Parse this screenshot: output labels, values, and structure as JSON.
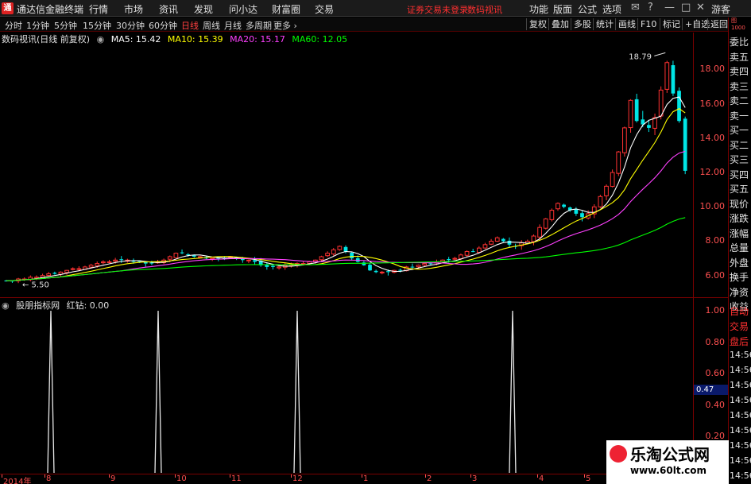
{
  "titlebar": {
    "app_name": "通达信金融终端",
    "menus": [
      "行情",
      "市场",
      "资讯",
      "发现",
      "问小达",
      "财富圈",
      "交易"
    ],
    "warning": "证券交易未登录",
    "stock_name": "数码视讯",
    "right_menus": [
      "功能",
      "版面",
      "公式",
      "选项"
    ],
    "user": "游客",
    "logo_char": "通"
  },
  "periodbar": {
    "periods": [
      "分时",
      "1分钟",
      "5分钟",
      "15分钟",
      "30分钟",
      "60分钟",
      "日线",
      "周线",
      "月线",
      "多周期",
      "更多 ›"
    ],
    "active": "日线",
    "right_buttons": [
      "复权",
      "叠加",
      "多股",
      "统计",
      "画线",
      "F10",
      "标记",
      "+自选",
      "返回"
    ]
  },
  "main_legend": {
    "title": "数码视讯(日线 前复权)",
    "ma5": "MA5: 15.42",
    "ma10": "MA10: 15.39",
    "ma20": "MA20: 15.17",
    "ma60": "MA60: 12.05"
  },
  "indicator_legend": {
    "name": "股朋指标网",
    "value": "红钻: 0.00"
  },
  "colors": {
    "up": "#ff3232",
    "down": "#00e6e6",
    "ma5": "#ffffff",
    "ma10": "#ffff00",
    "ma20": "#ff40ff",
    "ma60": "#00ff00",
    "axis": "#ff5050"
  },
  "chart_data": {
    "type": "candlestick",
    "price_axis_ticks": [
      "18.00",
      "16.00",
      "14.00",
      "12.00",
      "10.00",
      "8.00",
      "6.00"
    ],
    "indicator_axis_ticks": [
      "1.00",
      "0.80",
      "0.60",
      "0.40",
      "0.20"
    ],
    "indicator_current_value": "0.47",
    "ylim": [
      5.2,
      19.5
    ],
    "high_label": "18.79",
    "low_label": "5.50",
    "last_close": 12.05,
    "x_labels": [
      "2014年",
      "8",
      "9",
      "10",
      "11",
      "12",
      "1",
      "2",
      "3",
      "4",
      "5"
    ],
    "indicator": {
      "name": "红钻",
      "spike_height": 1.0,
      "spikes_at_month": [
        "8",
        "10",
        "12",
        "4"
      ]
    },
    "price_path": [
      5.7,
      5.7,
      5.8,
      5.8,
      5.9,
      5.9,
      6.0,
      6.1,
      6.1,
      6.2,
      6.3,
      6.4,
      6.4,
      6.5,
      6.6,
      6.7,
      6.8,
      6.8,
      6.9,
      6.9,
      6.9,
      6.8,
      6.8,
      6.7,
      6.7,
      6.8,
      6.9,
      7.1,
      7.3,
      7.3,
      7.2,
      7.1,
      7.1,
      7.0,
      7.0,
      7.0,
      7.0,
      7.1,
      7.0,
      6.9,
      6.9,
      6.8,
      6.6,
      6.5,
      6.5,
      6.5,
      6.6,
      6.6,
      6.7,
      6.7,
      6.8,
      6.9,
      7.1,
      7.3,
      7.5,
      7.7,
      7.4,
      7.0,
      6.8,
      6.6,
      6.3,
      6.2,
      6.2,
      6.2,
      6.3,
      6.3,
      6.5,
      6.5,
      6.6,
      6.7,
      6.7,
      6.8,
      6.9,
      6.9,
      7.0,
      7.2,
      7.4,
      7.4,
      7.6,
      7.8,
      8.0,
      8.2,
      8.0,
      7.8,
      7.7,
      7.9,
      8.0,
      8.3,
      8.8,
      9.3,
      9.8,
      10.2,
      10.0,
      9.8,
      9.6,
      9.4,
      9.6,
      10.0,
      10.6,
      11.2,
      12.0,
      13.2,
      14.6,
      16.2,
      15.0,
      14.8,
      14.6,
      15.2,
      16.8,
      18.4,
      16.6,
      15.0,
      12.1
    ]
  },
  "sidepanel": {
    "top_small": "图 1000",
    "rows": [
      "委比",
      "卖五",
      "卖四",
      "卖三",
      "卖二",
      "卖一",
      "买一",
      "买二",
      "买三",
      "买四",
      "买五",
      "现价",
      "涨跌",
      "涨幅",
      "总量",
      "外盘",
      "换手",
      "净资",
      "收益"
    ],
    "rows2": [
      "自动",
      "交易",
      "盘后",
      "14:56",
      "14:56",
      "14:56",
      "14:56",
      "14:56",
      "14:56",
      "14:56",
      "14:56",
      "14:56"
    ]
  },
  "watermark": {
    "title": "乐淘公式网",
    "url": "www.60lt.com"
  }
}
